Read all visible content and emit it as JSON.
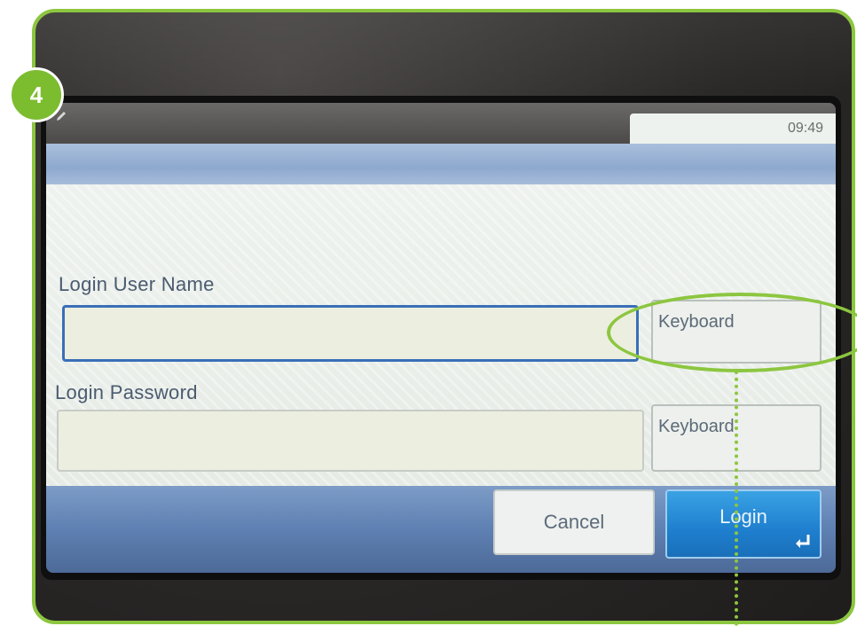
{
  "step": {
    "number": "4"
  },
  "status": {
    "time": "09:49"
  },
  "form": {
    "username_label": "Login User Name",
    "username_value": "",
    "username_keyboard": "Keyboard",
    "password_label": "Login Password",
    "password_value": "",
    "password_keyboard": "Keyboard"
  },
  "actions": {
    "cancel_label": "Cancel",
    "login_label": "Login"
  },
  "icons": {
    "edit": "pencil-icon",
    "enter": "enter-icon"
  },
  "colors": {
    "highlight": "#8cc63f",
    "focus_border": "#3a6fb7",
    "login_button": "#1e7fce"
  }
}
